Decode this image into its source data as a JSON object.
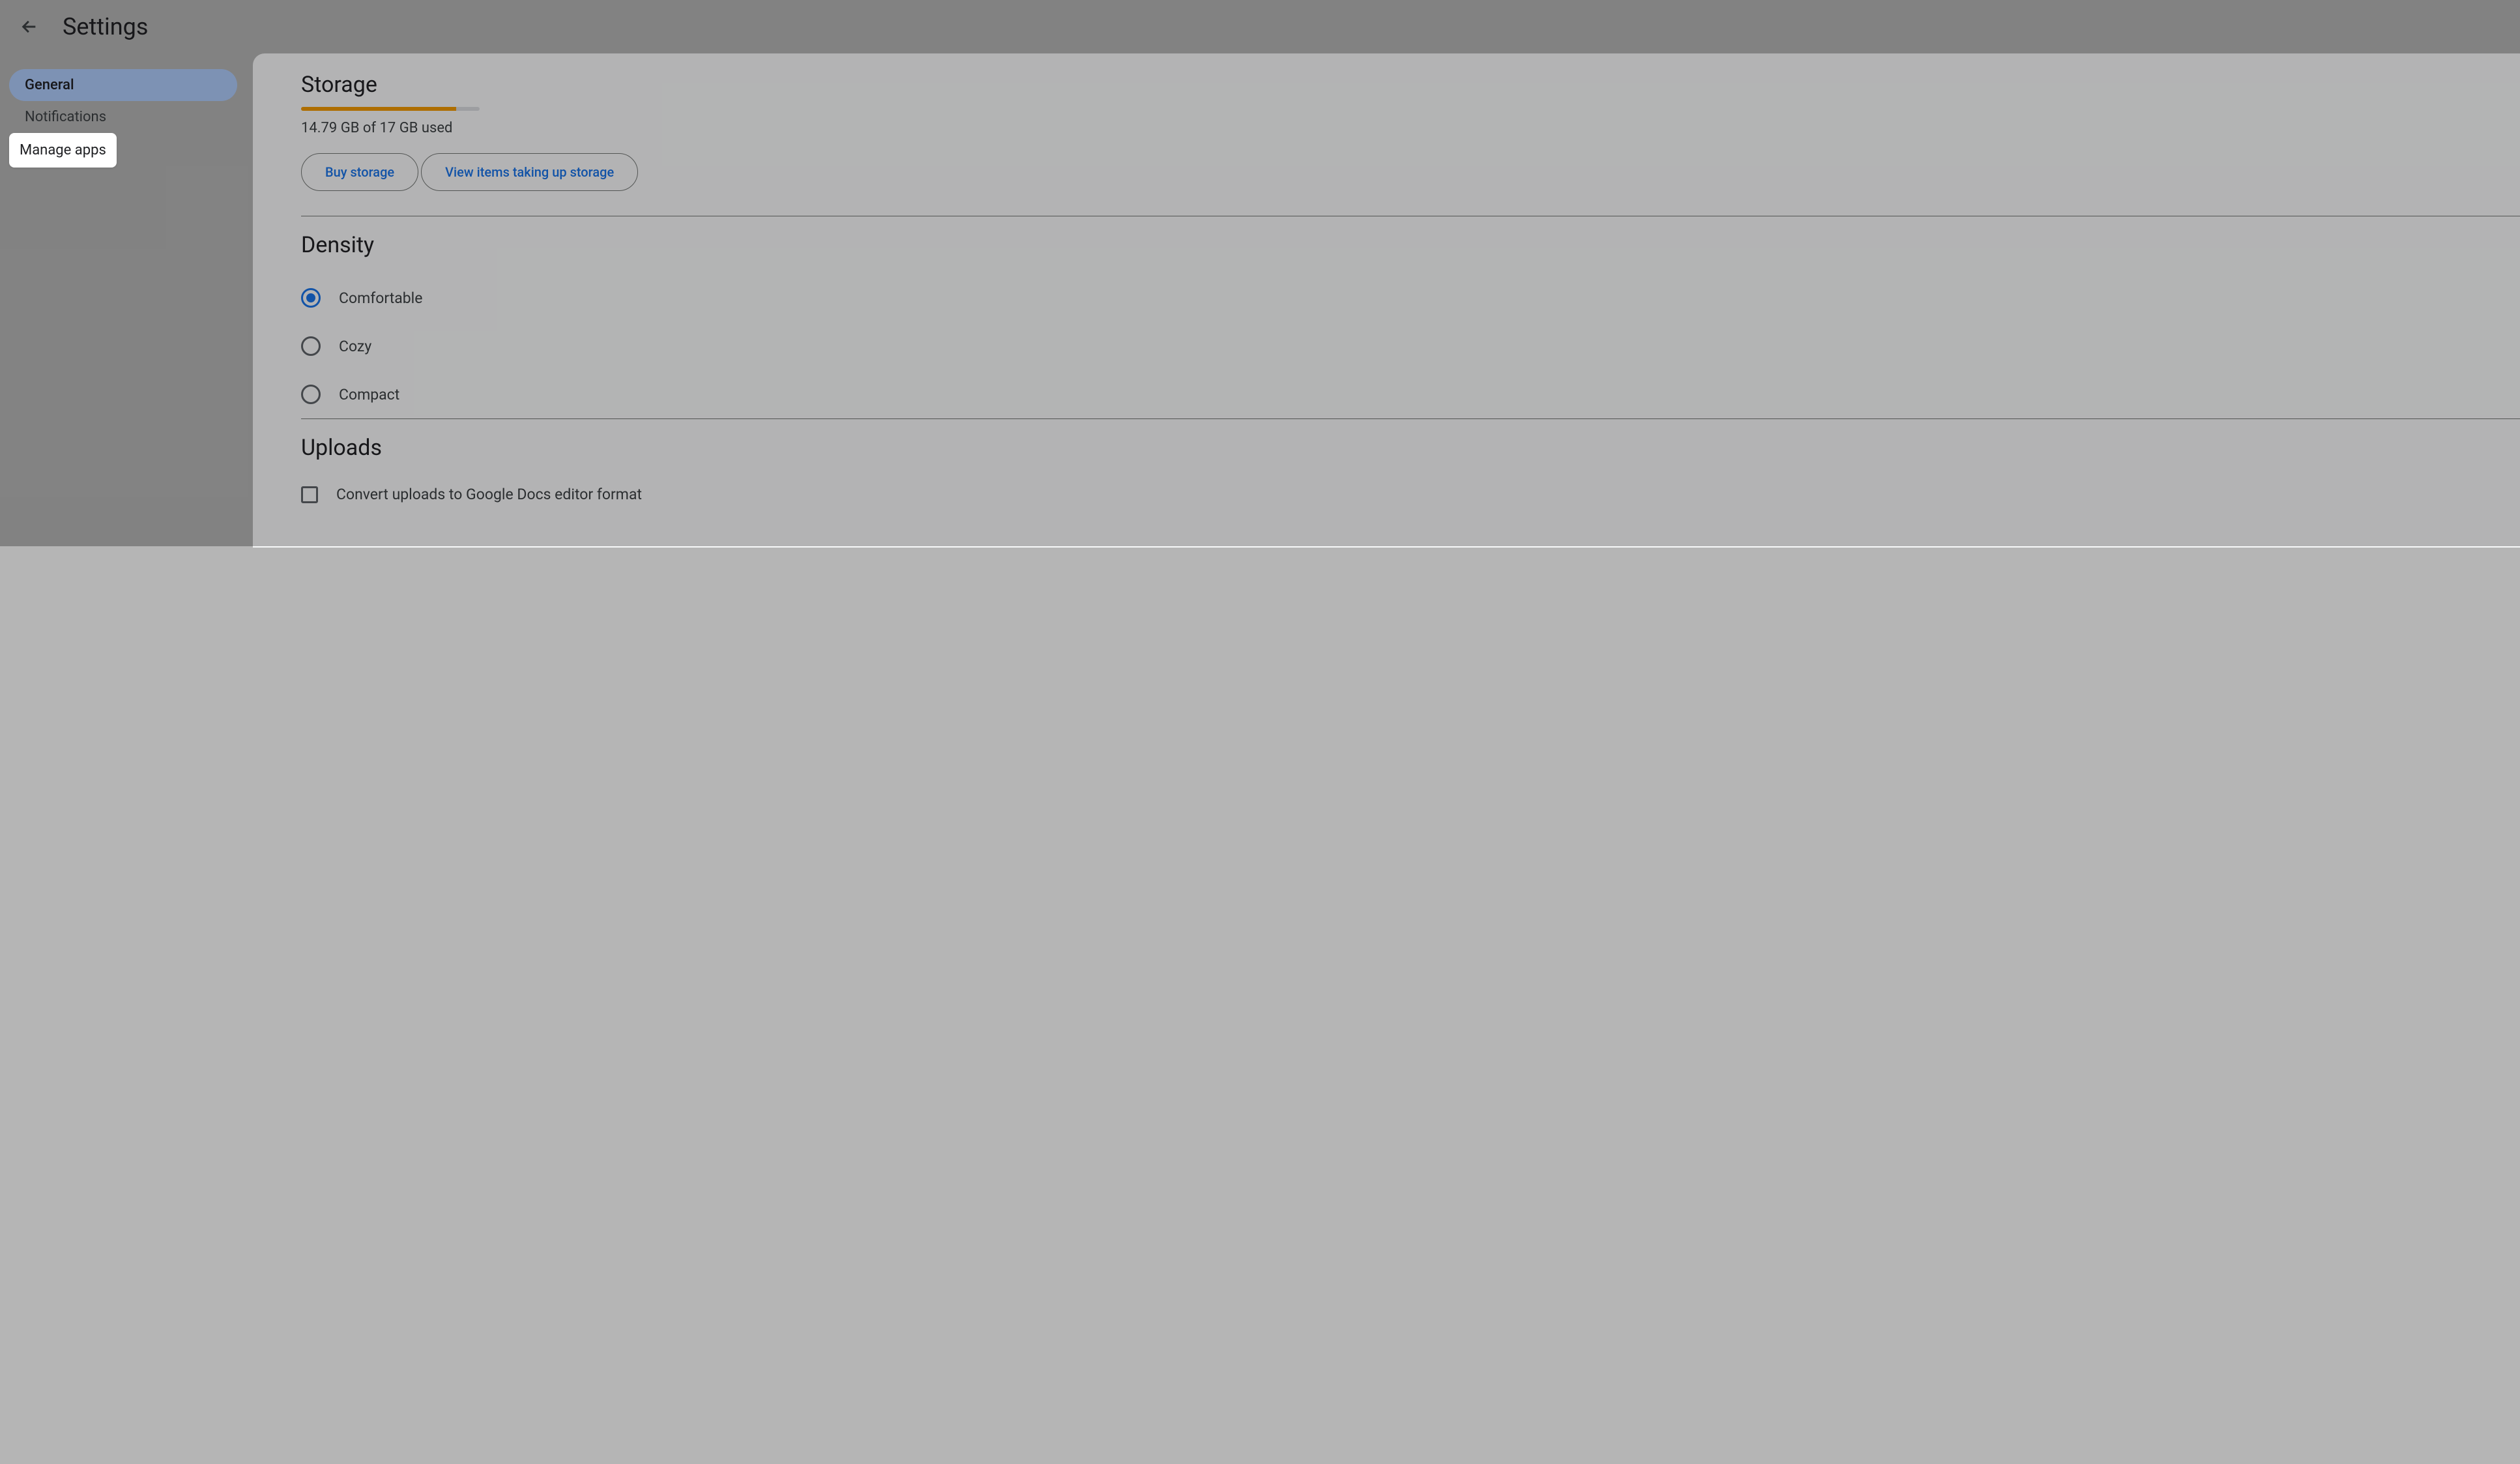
{
  "header": {
    "title": "Settings"
  },
  "sidebar": {
    "items": [
      {
        "label": "General",
        "state": "selected"
      },
      {
        "label": "Notifications",
        "state": "normal"
      },
      {
        "label": "Manage apps",
        "state": "highlighted"
      }
    ]
  },
  "storage": {
    "title": "Storage",
    "usage_text": "14.79 GB of 17 GB used",
    "used_gb": 14.79,
    "total_gb": 17,
    "percent": 87,
    "buy_button": "Buy storage",
    "view_button": "View items taking up storage"
  },
  "density": {
    "title": "Density",
    "options": [
      {
        "label": "Comfortable",
        "checked": true
      },
      {
        "label": "Cozy",
        "checked": false
      },
      {
        "label": "Compact",
        "checked": false
      }
    ]
  },
  "uploads": {
    "title": "Uploads",
    "convert_label": "Convert uploads to Google Docs editor format",
    "convert_checked": false
  }
}
